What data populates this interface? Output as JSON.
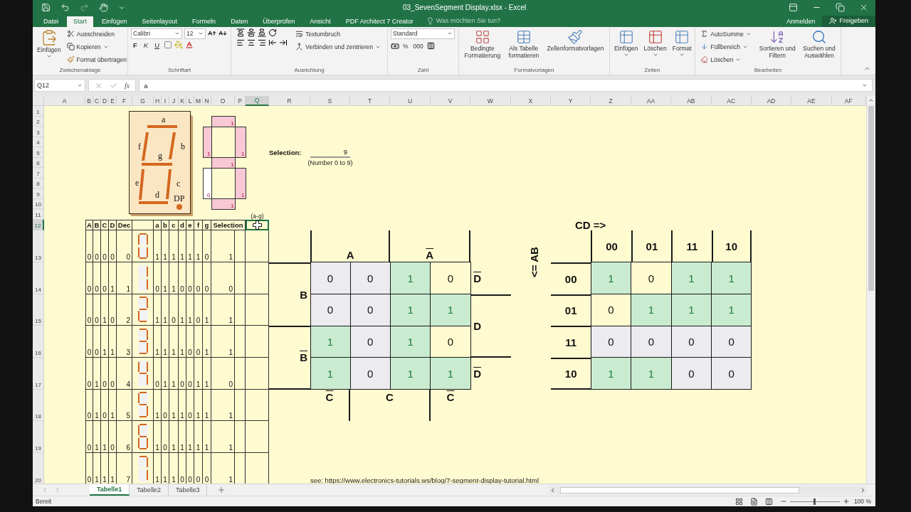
{
  "title_bar": {
    "title": "03_SevenSegment Display.xlsx - Excel"
  },
  "menu_tabs": [
    {
      "label": "Datei",
      "selected": false
    },
    {
      "label": "Start",
      "selected": true
    },
    {
      "label": "Einfügen",
      "selected": false
    },
    {
      "label": "Seitenlayout",
      "selected": false
    },
    {
      "label": "Formeln",
      "selected": false
    },
    {
      "label": "Daten",
      "selected": false
    },
    {
      "label": "Überprüfen",
      "selected": false
    },
    {
      "label": "Ansicht",
      "selected": false
    },
    {
      "label": "PDF Architect 7 Creator",
      "selected": false
    }
  ],
  "tell_me": {
    "placeholder": "Was möchten Sie tun?"
  },
  "account": {
    "sign_in": "Anmelden",
    "share": "Freigeben"
  },
  "clipboard": {
    "label": "Zwischenablage",
    "paste": "Einfügen",
    "cut": "Ausschneiden",
    "copy": "Kopieren",
    "format_painter": "Format übertragen"
  },
  "font": {
    "label": "Schriftart",
    "font_name": "Calibri",
    "font_size": "12",
    "bold": "F",
    "italic": "K",
    "underline": "U"
  },
  "alignment": {
    "label": "Ausrichtung",
    "wrap_text": "Textumbruch",
    "merge_center": "Verbinden und zentrieren"
  },
  "number": {
    "label": "Zahl",
    "format": "Standard",
    "percent": "%",
    "thousands": "000"
  },
  "styles": {
    "label": "Formatvorlagen",
    "buttons": [
      {
        "lines": [
          "Bedingte",
          "Formatierung"
        ]
      },
      {
        "lines": [
          "Als Tabelle",
          "formatieren"
        ]
      },
      {
        "lines": [
          "Zellenformatvorlagen"
        ]
      }
    ]
  },
  "cells": {
    "label": "Zellen",
    "buttons": [
      "Einfügen",
      "Löschen",
      "Format"
    ]
  },
  "editing": {
    "label": "Bearbeiten",
    "autosum": "AutoSumme",
    "fill": "Füllbereich",
    "clear": "Löschen",
    "sort": [
      "Sortieren und",
      "Filtern"
    ],
    "find": [
      "Suchen und",
      "Auswählen"
    ]
  },
  "formula_bar": {
    "name_box": "Q12",
    "fx": "fx",
    "value": "a"
  },
  "columns": [
    {
      "label": "A",
      "selected": false
    },
    {
      "label": "B",
      "selected": false
    },
    {
      "label": "C",
      "selected": false
    },
    {
      "label": "D",
      "selected": false
    },
    {
      "label": "E",
      "selected": false
    },
    {
      "label": "F",
      "selected": false
    },
    {
      "label": "G",
      "selected": false
    },
    {
      "label": "H",
      "selected": false
    },
    {
      "label": "I",
      "selected": false
    },
    {
      "label": "J",
      "selected": false
    },
    {
      "label": "K",
      "selected": false
    },
    {
      "label": "L",
      "selected": false
    },
    {
      "label": "M",
      "selected": false
    },
    {
      "label": "N",
      "selected": false
    },
    {
      "label": "O",
      "selected": false
    },
    {
      "label": "P",
      "selected": false
    },
    {
      "label": "Q",
      "selected": true
    },
    {
      "label": "R",
      "selected": false
    },
    {
      "label": "S",
      "selected": false
    },
    {
      "label": "T",
      "selected": false
    },
    {
      "label": "U",
      "selected": false
    },
    {
      "label": "V",
      "selected": false
    },
    {
      "label": "W",
      "selected": false
    },
    {
      "label": "X",
      "selected": false
    },
    {
      "label": "Y",
      "selected": false
    },
    {
      "label": "Z",
      "selected": false
    },
    {
      "label": "AA",
      "selected": false
    },
    {
      "label": "AB",
      "selected": false
    },
    {
      "label": "AC",
      "selected": false
    },
    {
      "label": "AD",
      "selected": false
    },
    {
      "label": "AE",
      "selected": false
    },
    {
      "label": "AF",
      "selected": false
    }
  ],
  "rows": [
    {
      "label": "1",
      "selected": false
    },
    {
      "label": "2",
      "selected": false
    },
    {
      "label": "3",
      "selected": false
    },
    {
      "label": "4",
      "selected": false
    },
    {
      "label": "5",
      "selected": false
    },
    {
      "label": "6",
      "selected": false
    },
    {
      "label": "7",
      "selected": false
    },
    {
      "label": "8",
      "selected": false
    },
    {
      "label": "9",
      "selected": false
    },
    {
      "label": "10",
      "selected": false
    },
    {
      "label": "11",
      "selected": false
    },
    {
      "label": "12",
      "selected": true
    },
    {
      "label": "13",
      "selected": false
    },
    {
      "label": "14",
      "selected": false
    },
    {
      "label": "15",
      "selected": false
    },
    {
      "label": "16",
      "selected": false
    },
    {
      "label": "17",
      "selected": false
    },
    {
      "label": "18",
      "selected": false
    },
    {
      "label": "19",
      "selected": false
    },
    {
      "label": "20",
      "selected": false
    }
  ],
  "display_labels": [
    "a",
    "b",
    "c",
    "d",
    "e",
    "f",
    "g",
    "DP"
  ],
  "segment_map": [
    {
      "value": "1"
    },
    {
      "value": "1"
    },
    {
      "value": "1"
    },
    {
      "value": "1"
    },
    {
      "value": "0"
    },
    {
      "value": "1"
    },
    {
      "value": "1"
    }
  ],
  "selection": {
    "label": "Selection:",
    "value": "9",
    "hint": "(Number 0 to 9)"
  },
  "truth_table": {
    "note": "(a-g)",
    "inputs": [
      "A",
      "B",
      "C",
      "D"
    ],
    "dec": "Dec",
    "segments": [
      "a",
      "b",
      "c",
      "d",
      "e",
      "f",
      "g"
    ],
    "selection": "Selection",
    "active_cell": {
      "selected": true
    },
    "rows": [
      {
        "inputs": [
          "0",
          "0",
          "0",
          "0"
        ],
        "dec": "0",
        "segments": [
          "1",
          "1",
          "1",
          "1",
          "1",
          "1",
          "0"
        ],
        "selection": "1"
      },
      {
        "inputs": [
          "0",
          "0",
          "0",
          "1"
        ],
        "dec": "1",
        "segments": [
          "0",
          "1",
          "1",
          "0",
          "0",
          "0",
          "0"
        ],
        "selection": "0"
      },
      {
        "inputs": [
          "0",
          "0",
          "1",
          "0"
        ],
        "dec": "2",
        "segments": [
          "1",
          "1",
          "0",
          "1",
          "1",
          "0",
          "1"
        ],
        "selection": "1"
      },
      {
        "inputs": [
          "0",
          "0",
          "1",
          "1"
        ],
        "dec": "3",
        "segments": [
          "1",
          "1",
          "1",
          "1",
          "0",
          "0",
          "1"
        ],
        "selection": "1"
      },
      {
        "inputs": [
          "0",
          "1",
          "0",
          "0"
        ],
        "dec": "4",
        "segments": [
          "0",
          "1",
          "1",
          "0",
          "0",
          "1",
          "1"
        ],
        "selection": "0"
      },
      {
        "inputs": [
          "0",
          "1",
          "0",
          "1"
        ],
        "dec": "5",
        "segments": [
          "1",
          "0",
          "1",
          "1",
          "0",
          "1",
          "1"
        ],
        "selection": "1"
      },
      {
        "inputs": [
          "0",
          "1",
          "1",
          "0"
        ],
        "dec": "6",
        "segments": [
          "1",
          "0",
          "1",
          "1",
          "1",
          "1",
          "1"
        ],
        "selection": "1"
      },
      {
        "inputs": [
          "0",
          "1",
          "1",
          "1"
        ],
        "dec": "7",
        "segments": [
          "1",
          "1",
          "1",
          "0",
          "0",
          "0",
          "0"
        ],
        "selection": "1"
      }
    ]
  },
  "kmap_left": {
    "top": [
      {
        "text": "A",
        "negated": false
      },
      {
        "text": "A",
        "negated": true
      }
    ],
    "left": [
      {
        "text": "B",
        "negated": false
      },
      {
        "text": "B",
        "negated": true
      }
    ],
    "right": [
      {
        "text": "D",
        "negated": true
      },
      {
        "text": "D",
        "negated": false
      },
      {
        "text": "D",
        "negated": true
      }
    ],
    "bottom": [
      {
        "text": "C",
        "negated": true
      },
      {
        "text": "C",
        "negated": false
      },
      {
        "text": "C",
        "negated": true
      }
    ],
    "cells": [
      [
        {
          "value": "0",
          "kind": "grey"
        },
        {
          "value": "0",
          "kind": "grey"
        },
        {
          "value": "1",
          "kind": "green"
        },
        {
          "value": "0",
          "kind": "plain"
        }
      ],
      [
        {
          "value": "0",
          "kind": "grey"
        },
        {
          "value": "0",
          "kind": "grey"
        },
        {
          "value": "1",
          "kind": "green"
        },
        {
          "value": "1",
          "kind": "green"
        }
      ],
      [
        {
          "value": "1",
          "kind": "green"
        },
        {
          "value": "0",
          "kind": "grey"
        },
        {
          "value": "1",
          "kind": "green"
        },
        {
          "value": "0",
          "kind": "plain"
        }
      ],
      [
        {
          "value": "1",
          "kind": "green"
        },
        {
          "value": "0",
          "kind": "grey"
        },
        {
          "value": "1",
          "kind": "green"
        },
        {
          "value": "1",
          "kind": "green"
        }
      ]
    ]
  },
  "kmap_right": {
    "col_title": "CD =>",
    "row_title": "<= AB",
    "col_heads": [
      "00",
      "01",
      "11",
      "10"
    ],
    "rows": [
      {
        "head": "00",
        "cells": [
          {
            "value": "1",
            "kind": "green"
          },
          {
            "value": "0",
            "kind": "plain"
          },
          {
            "value": "1",
            "kind": "green"
          },
          {
            "value": "1",
            "kind": "green"
          }
        ]
      },
      {
        "head": "01",
        "cells": [
          {
            "value": "0",
            "kind": "plain"
          },
          {
            "value": "1",
            "kind": "green"
          },
          {
            "value": "1",
            "kind": "green"
          },
          {
            "value": "1",
            "kind": "green"
          }
        ]
      },
      {
        "head": "11",
        "cells": [
          {
            "value": "0",
            "kind": "grey"
          },
          {
            "value": "0",
            "kind": "grey"
          },
          {
            "value": "0",
            "kind": "grey"
          },
          {
            "value": "0",
            "kind": "grey"
          }
        ]
      },
      {
        "head": "10",
        "cells": [
          {
            "value": "1",
            "kind": "green"
          },
          {
            "value": "1",
            "kind": "green"
          },
          {
            "value": "0",
            "kind": "grey"
          },
          {
            "value": "0",
            "kind": "grey"
          }
        ]
      }
    ]
  },
  "link": "see: https://www.electronics-tutorials.ws/blog/7-segment-display-tutorial.html",
  "sheet_tabs": [
    {
      "label": "Tabelle1",
      "selected": true
    },
    {
      "label": "Tabelle2",
      "selected": false
    },
    {
      "label": "Tabelle3",
      "selected": false
    }
  ],
  "status": {
    "text": "Bereit",
    "zoom": "100 %",
    "zoom_slider": {
      "level": 0.5
    }
  }
}
